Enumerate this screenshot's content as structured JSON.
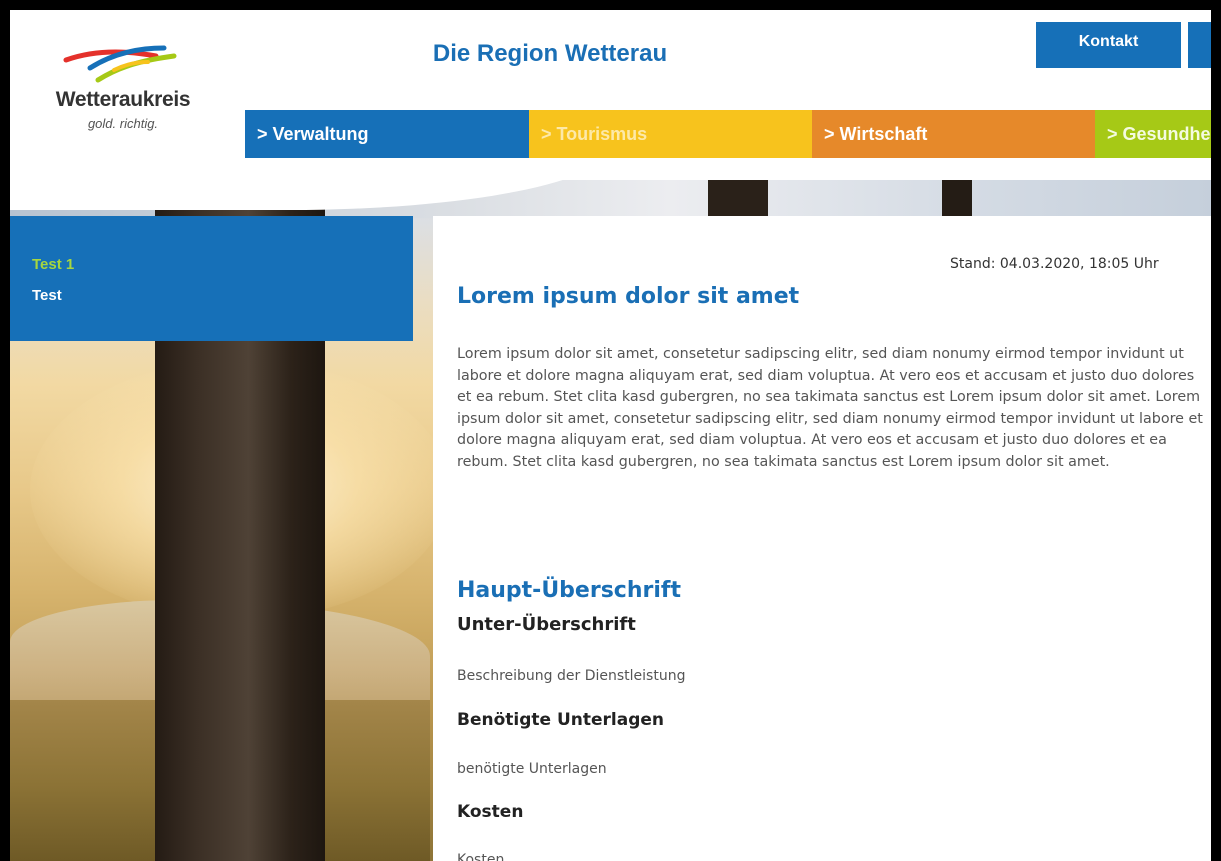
{
  "header": {
    "logo": {
      "name": "Wetteraukreis",
      "slogan": "gold. richtig."
    },
    "site_title": "Die Region Wetterau",
    "contact_label": "Kontakt"
  },
  "nav": [
    {
      "label": "> Verwaltung",
      "color": "#1670b8"
    },
    {
      "label": "> Tourismus",
      "color": "#f7c31d"
    },
    {
      "label": "> Wirtschaft",
      "color": "#e6892a"
    },
    {
      "label": "> Gesundheit",
      "color": "#a6c916"
    }
  ],
  "sidebar": {
    "items": [
      {
        "label": "Test 1"
      },
      {
        "label": "Test"
      }
    ]
  },
  "content": {
    "stand": "Stand: 04.03.2020, 18:05 Uhr",
    "lead_title": "Lorem ipsum dolor sit amet",
    "lead_text": "Lorem ipsum dolor sit amet, consetetur sadipscing elitr, sed diam nonumy eirmod tempor invidunt ut labore et dolore magna aliquyam erat, sed diam voluptua. At vero eos et accusam et justo duo dolores et ea rebum. Stet clita kasd gubergren, no sea takimata sanctus est Lorem ipsum dolor sit amet. Lorem ipsum dolor sit amet, consetetur sadipscing elitr, sed diam nonumy eirmod tempor invidunt ut labore et dolore magna aliquyam erat, sed diam voluptua. At vero eos et accusam et justo duo dolores et ea rebum. Stet clita kasd gubergren, no sea takimata sanctus est Lorem ipsum dolor sit amet.",
    "main_heading": "Haupt-Überschrift",
    "sub_heading": "Unter-Überschrift",
    "description": "Beschreibung der Dienstleistung",
    "documents_heading": "Benötigte Unterlagen",
    "documents_value": "benötigte Unterlagen",
    "costs_heading": "Kosten",
    "costs_value": "Kosten"
  },
  "colors": {
    "brand_blue": "#1670b8",
    "heading_blue": "#1a6fb5",
    "sidebar_active_green": "#a6d640"
  }
}
